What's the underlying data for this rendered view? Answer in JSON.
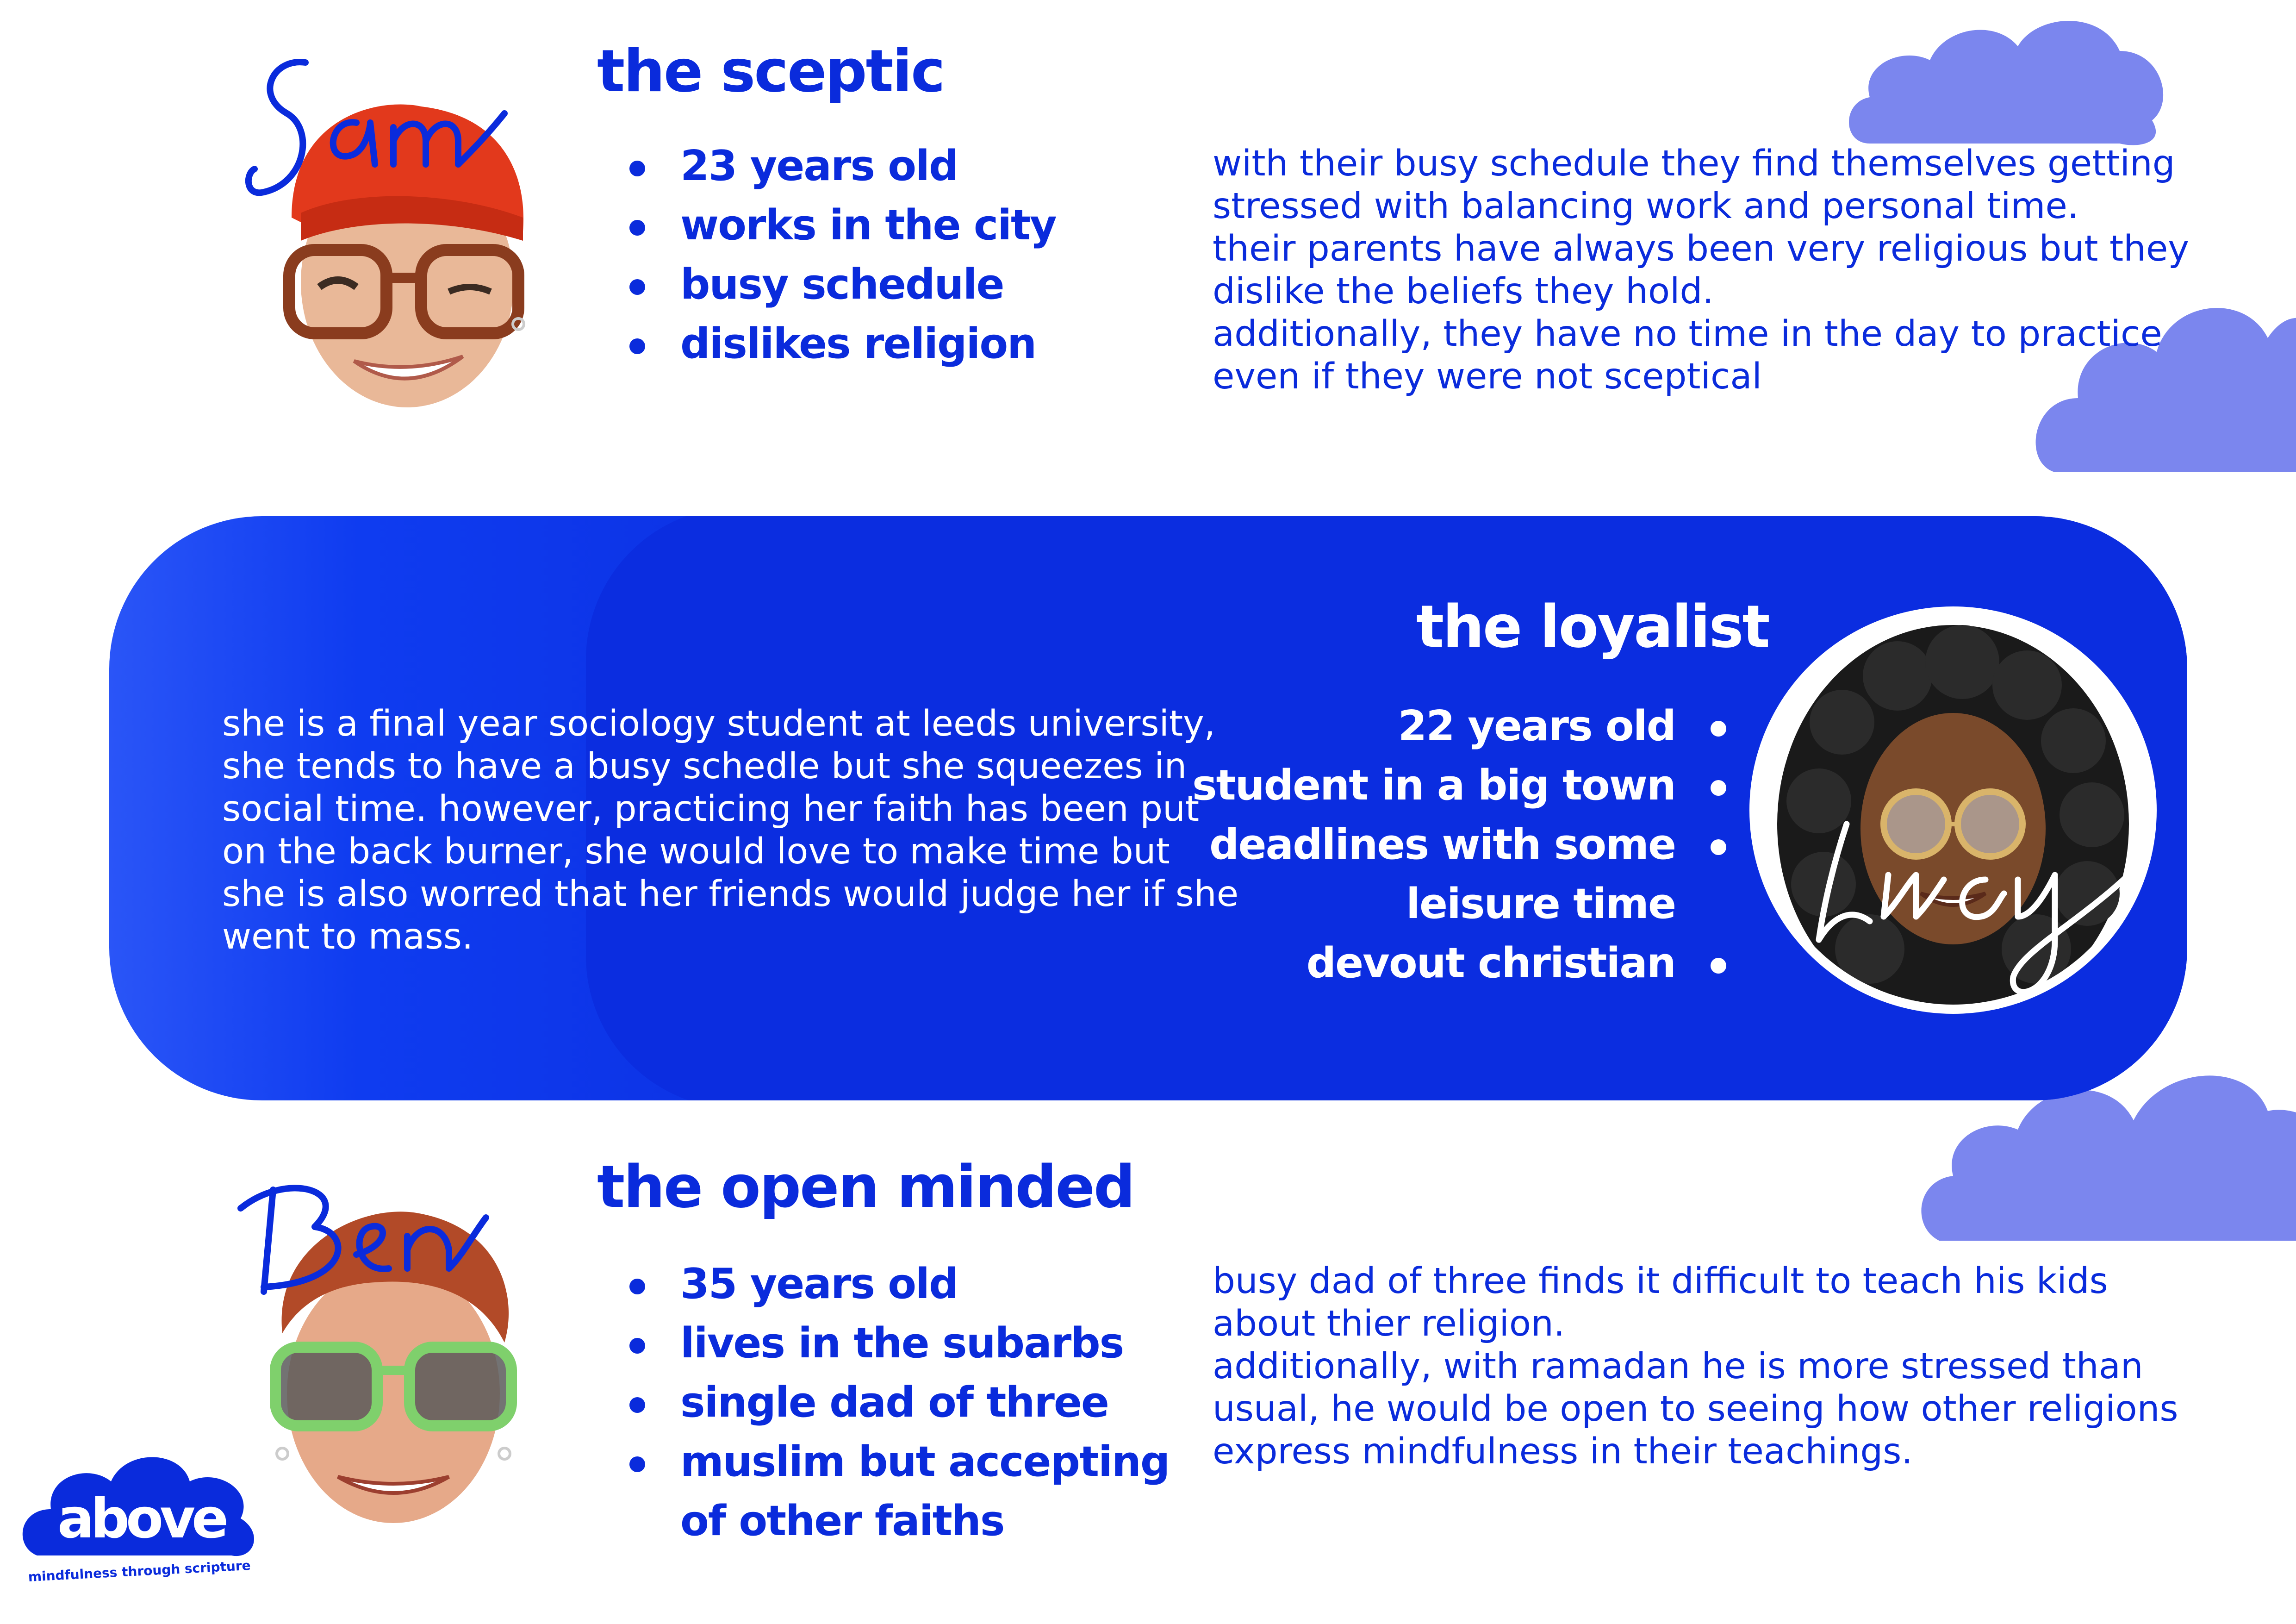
{
  "colors": {
    "accent": "#0a2bdc",
    "cloud": "#7b86ee",
    "background": "#ffffff"
  },
  "sceptic": {
    "signature": "Sam",
    "title": "the sceptic",
    "bullets": [
      "23 years old",
      "works in the city",
      "busy schedule",
      "dislikes religion"
    ],
    "description": [
      "with their busy schedule they find themselves getting",
      "stressed with balancing work and personal time.",
      "their parents have always been very religious but they",
      "dislike the beliefs they hold.",
      "additionally, they have no time in the day to practice",
      "even if they were not sceptical"
    ]
  },
  "loyalist": {
    "signature": "Lucy",
    "title": "the loyalist",
    "bullets": [
      "22 years old",
      "student in a big town",
      "deadlines with some",
      "leisure time",
      "devout christian"
    ],
    "description": [
      "she is a final year sociology student at leeds university,",
      "she tends to have a busy schedle but she squeezes in",
      "social time. however,  practicing her faith has been put",
      "on the back burner, she would love to make time but",
      "she is also worred that her friends would judge her if she",
      "went to mass."
    ]
  },
  "open_minded": {
    "signature": "Ben",
    "title": "the open minded",
    "bullets": [
      "35 years old",
      "lives in the subarbs",
      "single dad of three",
      "muslim but accepting",
      "of other faiths"
    ],
    "description": [
      "busy dad of three finds it difficult to teach his kids",
      "about thier religion.",
      "additionally, with ramadan he is more stressed than",
      "usual, he would be open to seeing how other religions",
      "express mindfulness in their teachings."
    ]
  },
  "logo": {
    "wordmark": "above",
    "tagline": "mindfulness through scripture"
  }
}
